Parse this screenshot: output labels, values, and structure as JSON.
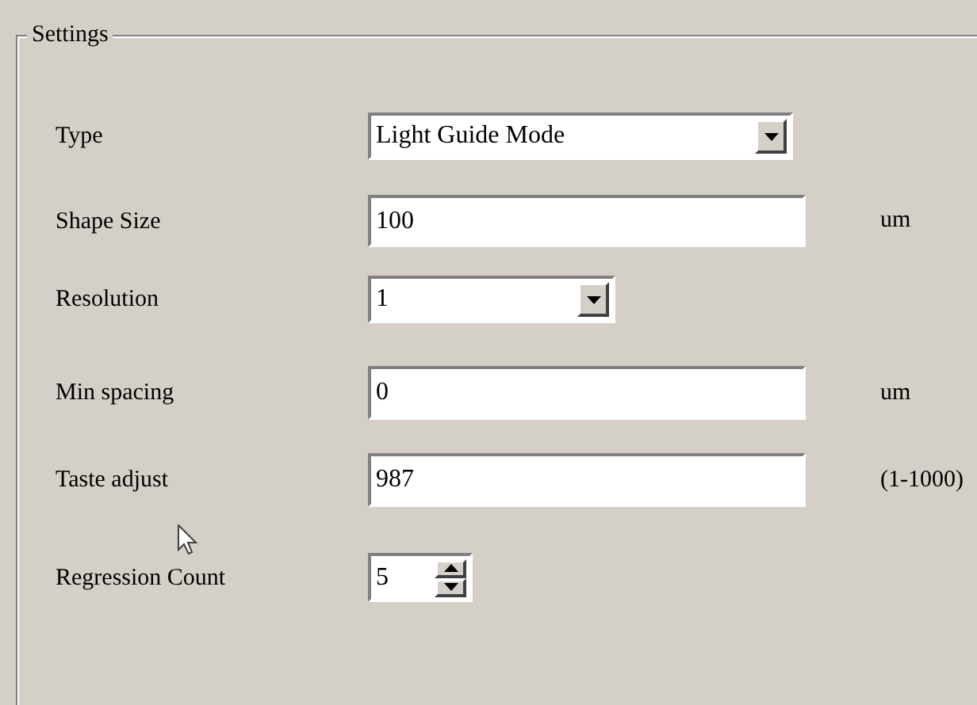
{
  "group": {
    "title": "Settings"
  },
  "fields": [
    {
      "kind": "dropdown",
      "label": "Type",
      "value": "Light Guide Mode"
    },
    {
      "kind": "text",
      "label": "Shape Size",
      "value": "100",
      "unit": "um"
    },
    {
      "kind": "dropdown",
      "label": "Resolution",
      "value": "1"
    },
    {
      "kind": "text",
      "label": "Min spacing",
      "value": "0",
      "unit": "um"
    },
    {
      "kind": "text",
      "label": "Taste adjust",
      "value": "987",
      "unit": "(1-1000)"
    },
    {
      "kind": "spinner",
      "label": "Regression Count",
      "value": "5"
    }
  ]
}
